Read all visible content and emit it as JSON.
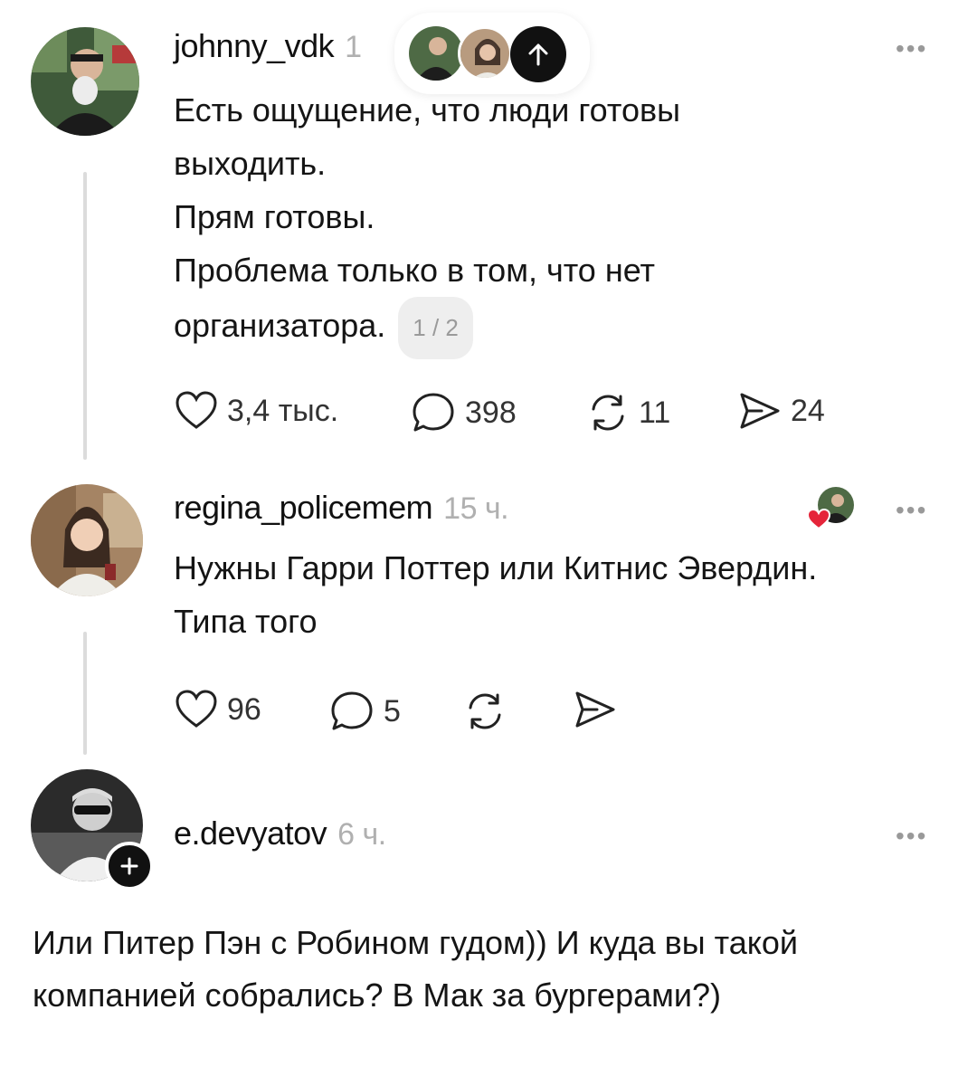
{
  "posts": [
    {
      "username": "johnny_vdk",
      "time_partial": "1",
      "lines": [
        "Есть ощущение, что люди готовы",
        "выходить.",
        "Прям готовы.",
        "Проблема только в том, что нет",
        "организатора."
      ],
      "page_counter": "1 / 2",
      "likes": "3,4 тыс.",
      "comments": "398",
      "reposts": "11",
      "shares": "24"
    },
    {
      "username": "regina_policemem",
      "time": "15 ч.",
      "lines": [
        "Нужны Гарри Поттер или Китнис Эвердин.",
        "Типа того"
      ],
      "likes": "96",
      "comments": "5"
    },
    {
      "username": "e.devyatov",
      "time": "6 ч.",
      "text": "Или Питер Пэн с Робином гудом)) И куда вы такой компанией собрались? В Мак за бургерами?)"
    }
  ],
  "icons": {
    "more": "more-icon",
    "like": "heart-icon",
    "comment": "comment-icon",
    "repost": "repost-icon",
    "share": "share-icon",
    "scroll_up": "arrow-up-icon",
    "follow": "plus-icon"
  },
  "colors": {
    "accent_black": "#111111",
    "muted": "#a8a8a8",
    "heart_red": "#e5253a"
  }
}
